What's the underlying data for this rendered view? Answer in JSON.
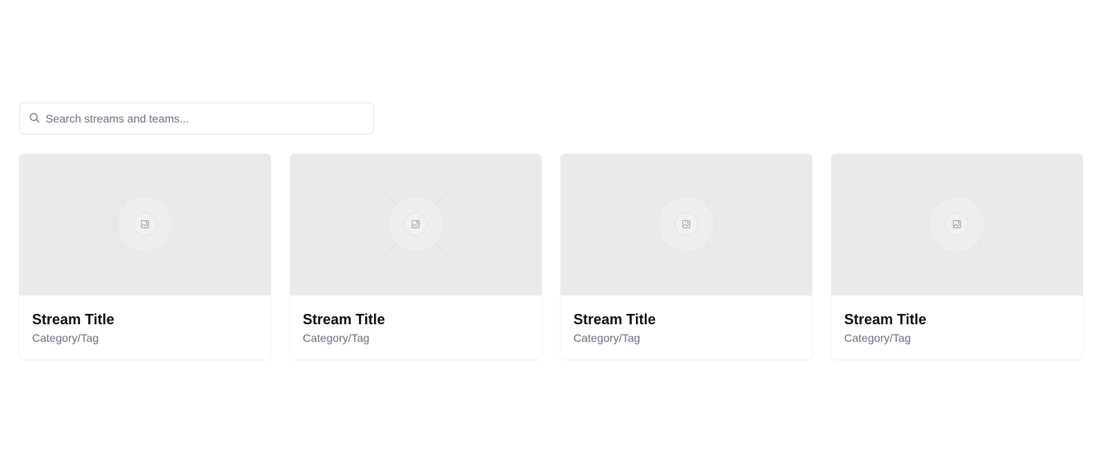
{
  "search": {
    "placeholder": "Search streams and teams...",
    "value": "",
    "icon": "search-icon"
  },
  "cards": [
    {
      "title": "Stream Title",
      "subtitle": "Category/Tag",
      "thumbnail_icon": "image-placeholder-icon"
    },
    {
      "title": "Stream Title",
      "subtitle": "Category/Tag",
      "thumbnail_icon": "image-placeholder-icon"
    },
    {
      "title": "Stream Title",
      "subtitle": "Category/Tag",
      "thumbnail_icon": "image-placeholder-icon"
    },
    {
      "title": "Stream Title",
      "subtitle": "Category/Tag",
      "thumbnail_icon": "image-placeholder-icon"
    }
  ],
  "colors": {
    "thumbnail_bg": "#e9e9e9",
    "title": "#111111",
    "subtitle": "#6b7280",
    "border": "#e3e5e8"
  }
}
